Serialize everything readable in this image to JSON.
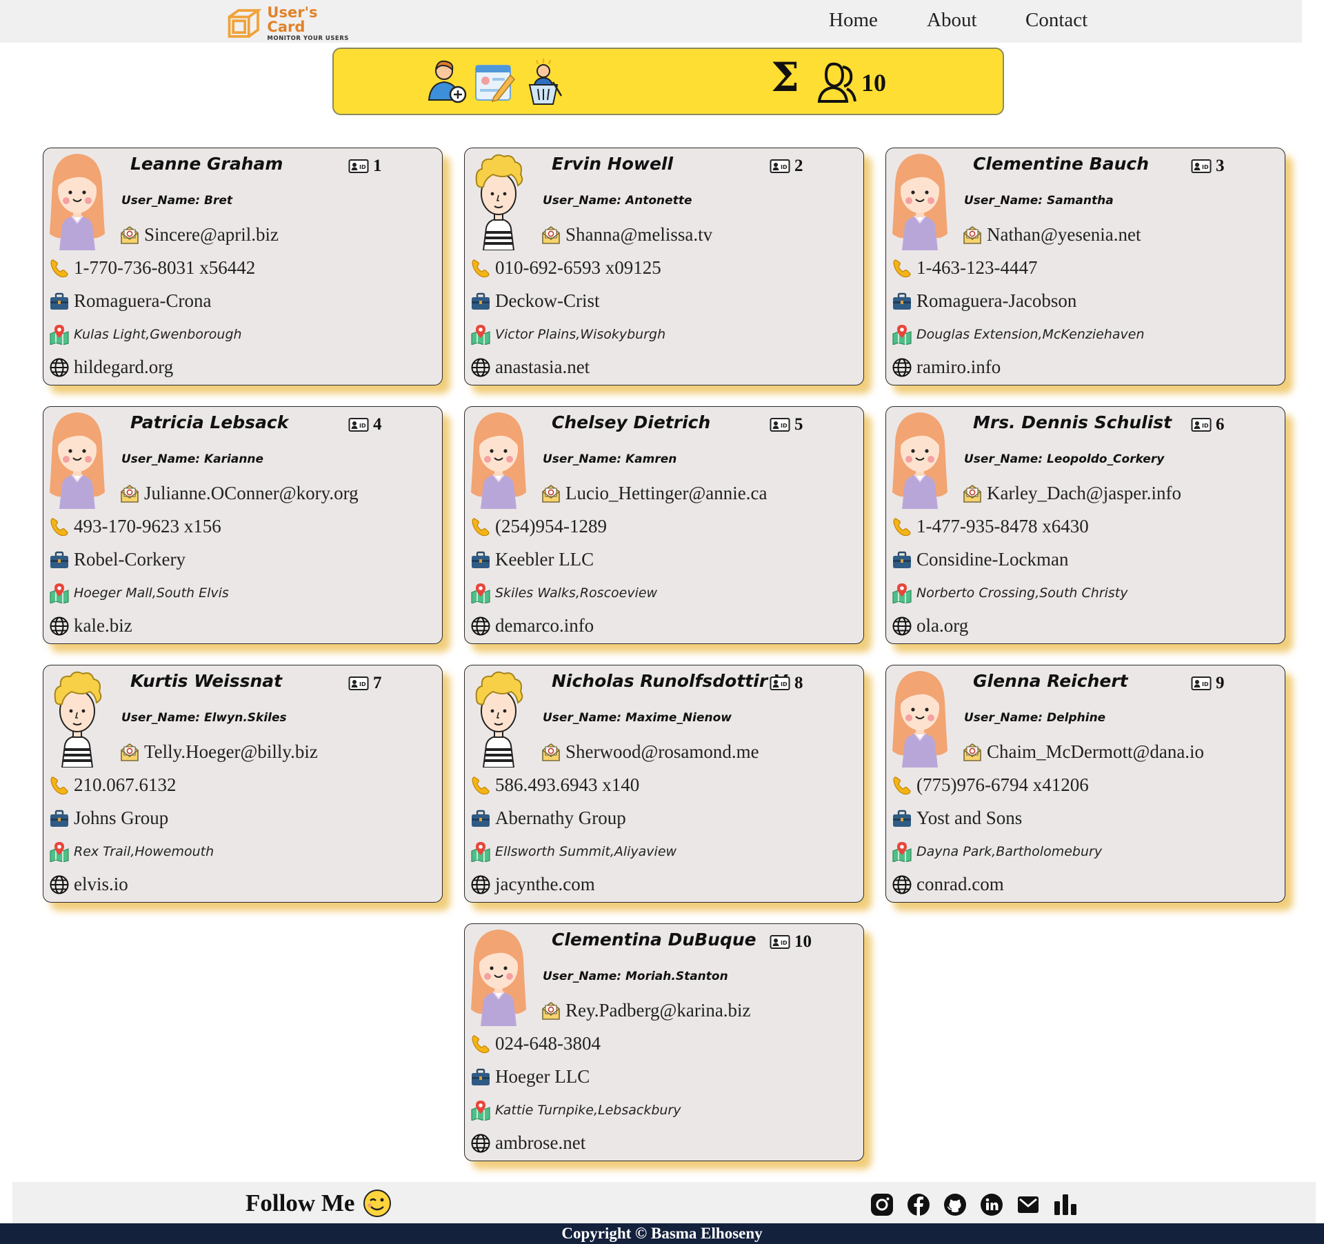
{
  "nav": {
    "logo_title": "User's Card",
    "logo_subtitle": "MONITOR YOUR USERS",
    "links": [
      "Home",
      "About",
      "Contact"
    ]
  },
  "toolbar": {
    "icons": [
      "add-user-icon",
      "edit-user-icon",
      "delete-user-icon"
    ],
    "sigma": "Σ",
    "total": "10"
  },
  "users": [
    {
      "id": "1",
      "name": "Leanne Graham",
      "username": "User_Name: Bret",
      "email": "Sincere@april.biz",
      "phone": "1-770-736-8031 x56442",
      "company": "Romaguera-Crona",
      "address": "Kulas Light,Gwenborough",
      "website": "hildegard.org",
      "avatar": "female"
    },
    {
      "id": "2",
      "name": "Ervin Howell",
      "username": "User_Name: Antonette",
      "email": "Shanna@melissa.tv",
      "phone": "010-692-6593 x09125",
      "company": "Deckow-Crist",
      "address": "Victor Plains,Wisokyburgh",
      "website": "anastasia.net",
      "avatar": "male"
    },
    {
      "id": "3",
      "name": "Clementine Bauch",
      "username": "User_Name: Samantha",
      "email": "Nathan@yesenia.net",
      "phone": "1-463-123-4447",
      "company": "Romaguera-Jacobson",
      "address": "Douglas Extension,McKenziehaven",
      "website": "ramiro.info",
      "avatar": "female"
    },
    {
      "id": "4",
      "name": "Patricia Lebsack",
      "username": "User_Name: Karianne",
      "email": "Julianne.OConner@kory.org",
      "phone": "493-170-9623 x156",
      "company": "Robel-Corkery",
      "address": "Hoeger Mall,South Elvis",
      "website": "kale.biz",
      "avatar": "female"
    },
    {
      "id": "5",
      "name": "Chelsey Dietrich",
      "username": "User_Name: Kamren",
      "email": "Lucio_Hettinger@annie.ca",
      "phone": "(254)954-1289",
      "company": "Keebler LLC",
      "address": "Skiles Walks,Roscoeview",
      "website": "demarco.info",
      "avatar": "female"
    },
    {
      "id": "6",
      "name": "Mrs. Dennis Schulist",
      "username": "User_Name: Leopoldo_Corkery",
      "email": "Karley_Dach@jasper.info",
      "phone": "1-477-935-8478 x6430",
      "company": "Considine-Lockman",
      "address": "Norberto Crossing,South Christy",
      "website": "ola.org",
      "avatar": "female"
    },
    {
      "id": "7",
      "name": "Kurtis Weissnat",
      "username": "User_Name: Elwyn.Skiles",
      "email": "Telly.Hoeger@billy.biz",
      "phone": "210.067.6132",
      "company": "Johns Group",
      "address": "Rex Trail,Howemouth",
      "website": "elvis.io",
      "avatar": "male"
    },
    {
      "id": "8",
      "name": "Nicholas Runolfsdottir V",
      "username": "User_Name: Maxime_Nienow",
      "email": "Sherwood@rosamond.me",
      "phone": "586.493.6943 x140",
      "company": "Abernathy Group",
      "address": "Ellsworth Summit,Aliyaview",
      "website": "jacynthe.com",
      "avatar": "male"
    },
    {
      "id": "9",
      "name": "Glenna Reichert",
      "username": "User_Name: Delphine",
      "email": "Chaim_McDermott@dana.io",
      "phone": "(775)976-6794 x41206",
      "company": "Yost and Sons",
      "address": "Dayna Park,Bartholomebury",
      "website": "conrad.com",
      "avatar": "female"
    },
    {
      "id": "10",
      "name": "Clementina DuBuque",
      "username": "User_Name: Moriah.Stanton",
      "email": "Rey.Padberg@karina.biz",
      "phone": "024-648-3804",
      "company": "Hoeger LLC",
      "address": "Kattie Turnpike,Lebsackbury",
      "website": "ambrose.net",
      "avatar": "female"
    }
  ],
  "footer": {
    "follow_text": "Follow Me",
    "social_icons": [
      "instagram-icon",
      "facebook-icon",
      "github-icon",
      "linkedin-icon",
      "mail-icon",
      "chart-icon"
    ],
    "copyright": "Copyright © Basma Elhoseny"
  },
  "colors": {
    "toolbar_bg": "#ffde33",
    "card_bg": "#ebe7e6",
    "card_shadow": "#ecbe50",
    "footer_bg": "#14213d",
    "logo_accent": "#e0822a"
  }
}
